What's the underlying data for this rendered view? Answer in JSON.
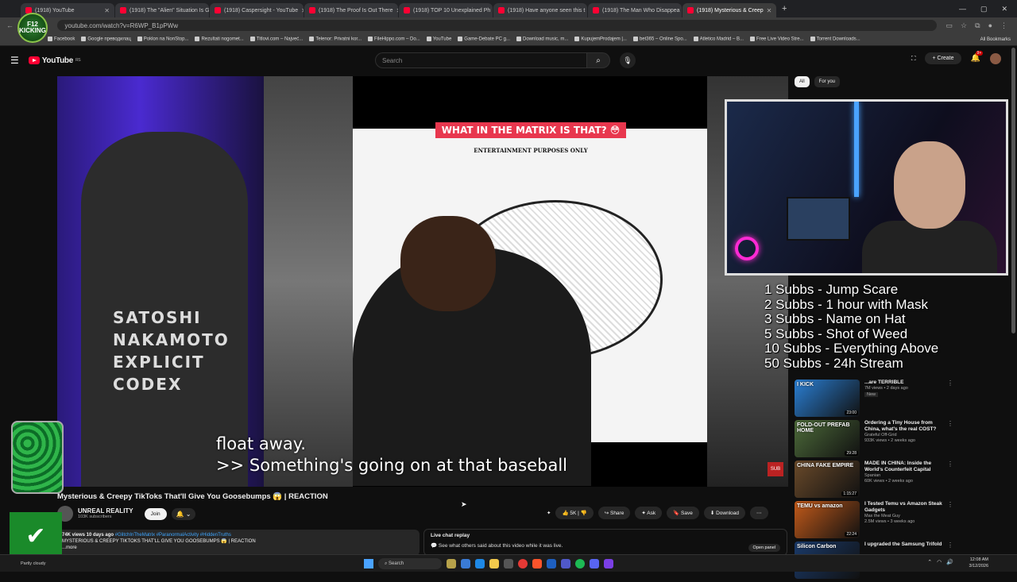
{
  "browser": {
    "tabs": [
      {
        "label": "(1918) YouTube",
        "active": false
      },
      {
        "label": "(1918) The \"Alien\" Situation Is G",
        "active": false
      },
      {
        "label": "(1918) Caspersight - YouTube",
        "active": false
      },
      {
        "label": "(1918) The Proof Is Out There",
        "active": false
      },
      {
        "label": "(1918) TOP 10 Unexplained Ph",
        "active": false
      },
      {
        "label": "(1918) Have anyone seen this t",
        "active": false
      },
      {
        "label": "(1918) The Man Who Disappea",
        "active": false
      },
      {
        "label": "(1918) Mysterious & Creep",
        "active": true
      }
    ],
    "url": "youtube.com/watch?v=R6WP_B1pPWw",
    "bookmarks": [
      "Facebook",
      "Google преводилац",
      "Poklon na NonStop...",
      "Rezultati nogomet...",
      "Titlovi.com – Najveć...",
      "Telenor: Privatni kor...",
      "FileHippo.com – Do...",
      "YouTube",
      "Game-Debate PC g...",
      "Download music, m...",
      "KupujemProdajem |...",
      "bet365 – Online Spo...",
      "Atletico Madrid – B...",
      "Free Live Video Stre...",
      "Torrent Downloads..."
    ],
    "all_bookmarks": "All Bookmarks"
  },
  "overlay_logo": "F12 KICKING",
  "youtube": {
    "logo": "YouTube",
    "region": "RS",
    "search_placeholder": "Search",
    "create_label": "Create",
    "notif_count": "9+",
    "chips": [
      "All",
      "For you"
    ]
  },
  "video": {
    "shirt_text": "SATOSHI NAKAMOTO EXPLICIT CODEX",
    "tiktok_title": "WHAT IN THE MATRIX IS THAT? 😳",
    "tiktok_sub": "ENTERTAINMENT PURPOSES ONLY",
    "caption_line1": "float away.",
    "caption_line2": ">> Something's going on at that baseball",
    "sub_button": "SUB",
    "title": "Mysterious & Creepy TikToks That'll Give You Goosebumps 😱 | REACTION",
    "channel": "UNREAL REALITY",
    "subscribers": "103K subscribers",
    "join": "Join",
    "likes": "5K",
    "share": "Share",
    "ask": "Ask",
    "save": "Save",
    "download": "Download",
    "desc_meta": "74K views  10 days ago ",
    "desc_tags": "#GlitchInTheMatrix #ParanormalActivity #HiddenTruths",
    "desc_text": "MYSTERIOUS & CREEPY TIKTOKS THAT'LL GIVE YOU GOOSEBUMPS 😱 | REACTION",
    "desc_more": "...more"
  },
  "live_chat": {
    "title": "Live chat replay",
    "text": "See what others said about this video while it was live.",
    "open": "Open panel"
  },
  "goals": [
    "1 Subbs - Jump Scare",
    "2 Subbs - 1 hour with Mask",
    "3 Subbs - Name on Hat",
    "5 Subbs - Shot of Weed",
    "10 Subbs - Everything Above",
    "50 Subbs - 24h Stream"
  ],
  "sidebar": [
    {
      "title": "...are TERRIBLE",
      "channel": "",
      "stats": "7M views • 2 days ago",
      "badge": "New",
      "duration": "23:00",
      "thumb_text": "I KICK",
      "color": "#2a7fd4"
    },
    {
      "title": "Ordering a Tiny House from China, what's the real COST?",
      "channel": "Grateful Off-Grid",
      "stats": "933K views • 2 weeks ago",
      "badge": "",
      "duration": "29:28",
      "thumb_text": "FOLD-OUT PREFAB HOME",
      "color": "#4d6b3a"
    },
    {
      "title": "MADE IN CHINA: Inside the World's Counterfeit Capital",
      "channel": "Spanian",
      "stats": "60K views • 2 weeks ago",
      "badge": "",
      "duration": "1:15:27",
      "thumb_text": "CHINA FAKE EMPIRE",
      "color": "#6a4a2a"
    },
    {
      "title": "I Tested Temu vs Amazon Steak Gadgets",
      "channel": "Max the Meat Guy",
      "stats": "2.5M views • 3 weeks ago",
      "badge": "",
      "duration": "22:24",
      "thumb_text": "TEMU vs amazon",
      "color": "#c25a1a"
    },
    {
      "title": "I upgraded the Samsung Trifold",
      "channel": "",
      "stats": "",
      "badge": "",
      "duration": "",
      "thumb_text": "Silicon Carbon",
      "color": "#1a3a6a"
    }
  ],
  "taskbar": {
    "weather": "Partly cloudy",
    "search": "Search",
    "time": "12:08 AM",
    "date": "3/12/2026"
  }
}
